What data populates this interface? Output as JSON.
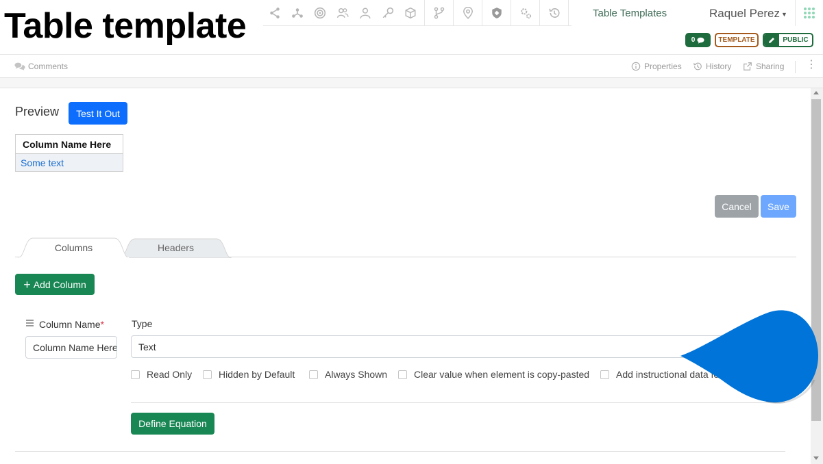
{
  "header": {
    "page_title": "Table template",
    "nav_link": "Table Templates",
    "user_name": "Raquel Perez",
    "icons": [
      "share-icon",
      "network-icon",
      "gear-badge-icon",
      "users-icon",
      "user-icon",
      "key-icon",
      "cube-icon",
      "branch-icon",
      "map-pin-icon",
      "shield-icon",
      "settings-icon",
      "history-icon"
    ]
  },
  "badges": {
    "comment_count": "0",
    "template": "TEMPLATE",
    "public": "PUBLIC"
  },
  "toolbar": {
    "comments": "Comments",
    "properties": "Properties",
    "history": "History",
    "sharing": "Sharing"
  },
  "preview": {
    "label": "Preview",
    "test_button": "Test It Out",
    "table_header": "Column Name Here",
    "table_cell": "Some text"
  },
  "actions": {
    "cancel": "Cancel",
    "save": "Save"
  },
  "tabs": [
    {
      "label": "Columns",
      "active": true
    },
    {
      "label": "Headers",
      "active": false
    }
  ],
  "add_column": "Add Column",
  "column": {
    "name_label": "Column Name",
    "required_mark": "*",
    "name_value": "Column Name Here",
    "type_label": "Type",
    "type_value": "Text",
    "checkboxes": [
      "Read Only",
      "Hidden by Default",
      "Always Shown",
      "Clear value when element is copy-pasted",
      "Add instructional data for"
    ],
    "equation_button": "Define Equation"
  },
  "colors": {
    "primary": "#0d6efd",
    "success": "#198754",
    "template_badge": "#a35a1c",
    "cursor_drop": "#0074d9"
  }
}
